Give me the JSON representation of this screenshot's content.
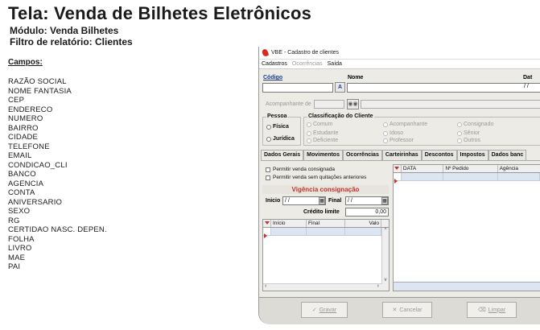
{
  "doc": {
    "title": "Tela: Venda de Bilhetes Eletrônicos",
    "module": "Módulo: Venda Bilhetes",
    "filter": "Filtro de relatório: Clientes",
    "fields_label": "Campos:",
    "fields": [
      "RAZÃO SOCIAL",
      "NOME FANTASIA",
      "CEP",
      "ENDERECO",
      "NUMERO",
      "BAIRRO",
      "CIDADE",
      "TELEFONE",
      "EMAIL",
      "CONDICAO_CLI",
      "BANCO",
      "AGENCIA",
      "CONTA",
      "ANIVERSARIO",
      "SEXO",
      "RG",
      "CERTIDAO NASC. DEPEN.",
      "FOLHA",
      "LIVRO",
      "MAE",
      "PAI"
    ]
  },
  "window": {
    "title": "VBE - Cadastro de clientes",
    "menu": {
      "cadastros": "Cadastros",
      "ocorrencias": "Ocorrências",
      "saida": "Saída"
    },
    "codigo_label": "Código",
    "nome_label": "Nome",
    "data_label": "Dat",
    "data_value": "/ /",
    "acompanhante_label": "Acompanhante de",
    "pessoa": {
      "title": "Pessoa",
      "fisica": "Física",
      "juridica": "Jurídica"
    },
    "classificacao": {
      "title": "Classificação do Cliente",
      "options": [
        "Comum",
        "Acompanhante",
        "Consignado",
        "Estudante",
        "Idoso",
        "Sênior",
        "Deficiente",
        "Professor",
        "Outros"
      ]
    },
    "tabs": [
      "Dados Gerais",
      "Movimentos",
      "Ocorrências",
      "Carteirinhas",
      "Descontos",
      "Impostos",
      "Dados banc"
    ],
    "checks": {
      "consignada": "Permitir venda consignada",
      "quitacoes": "Permitir venda sem quitações anteriores"
    },
    "vigencia_title": "Vigência consignação",
    "inicio_label": "Inicio",
    "inicio_value": "/ /",
    "final_label": "Final",
    "final_value": "/ /",
    "credito_label": "Crédito limite",
    "credito_value": "0,00",
    "left_grid_cols": [
      "Início",
      "Final",
      "Valo"
    ],
    "right_grid_cols": [
      "DATA",
      "Nº Pedido",
      "Agência"
    ],
    "buttons": {
      "gravar": "Gravar",
      "cancelar": "Cancelar",
      "limpar": "Limpar"
    }
  }
}
